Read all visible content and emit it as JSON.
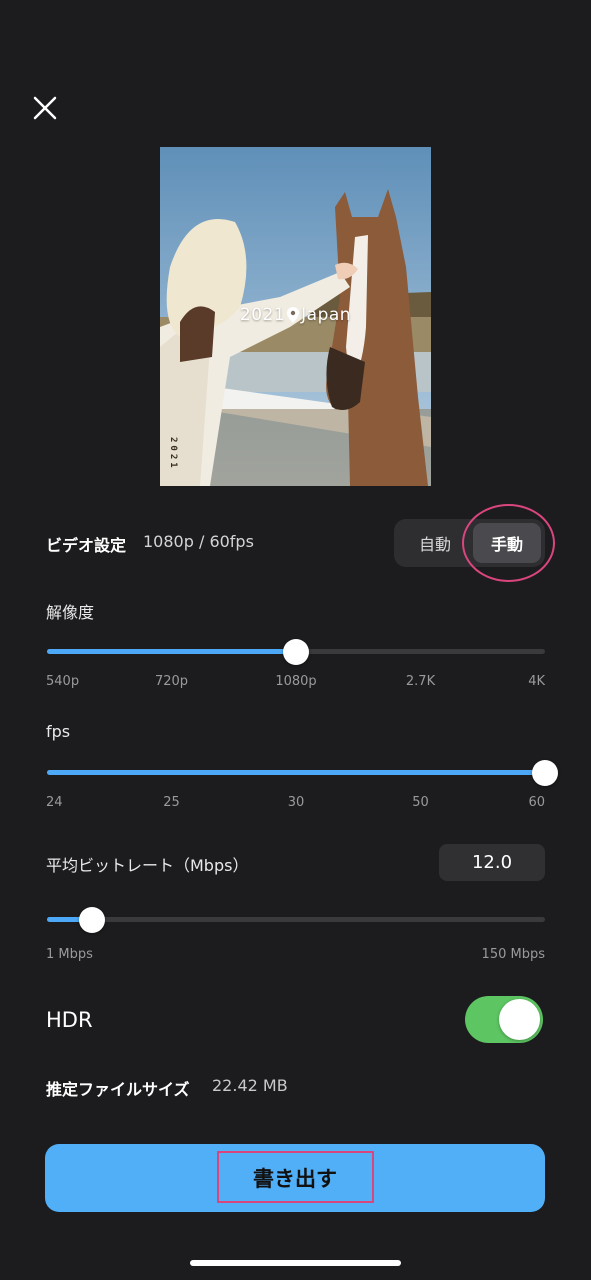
{
  "icons": {
    "close": "close-icon",
    "location": "location-pin-icon"
  },
  "preview": {
    "overlay_year": "2021",
    "overlay_place": "Japan",
    "vertical_text": "2021"
  },
  "video_settings": {
    "label": "ビデオ設定",
    "value": "1080p / 60fps",
    "mode_auto": "自動",
    "mode_manual": "手動",
    "selected_mode": "手動"
  },
  "resolution": {
    "label": "解像度",
    "ticks": [
      "540p",
      "720p",
      "1080p",
      "2.7K",
      "4K"
    ],
    "selected": "1080p",
    "level": 0.5
  },
  "fps": {
    "label": "fps",
    "ticks": [
      "24",
      "25",
      "30",
      "50",
      "60"
    ],
    "selected": "60",
    "level": 1.0
  },
  "bitrate": {
    "label": "平均ビットレート（Mbps）",
    "value": "12.0",
    "min_label": "1 Mbps",
    "max_label": "150 Mbps",
    "level": 0.09
  },
  "hdr": {
    "label": "HDR",
    "enabled": true
  },
  "file_size": {
    "label": "推定ファイルサイズ",
    "value": "22.42 MB"
  },
  "export": {
    "label": "書き出す"
  },
  "colors": {
    "background": "#1c1c1e",
    "accent": "#4da9f7",
    "export_button": "#51aff8",
    "toggle_on": "#5dc562",
    "annotation": "#d9467e"
  }
}
